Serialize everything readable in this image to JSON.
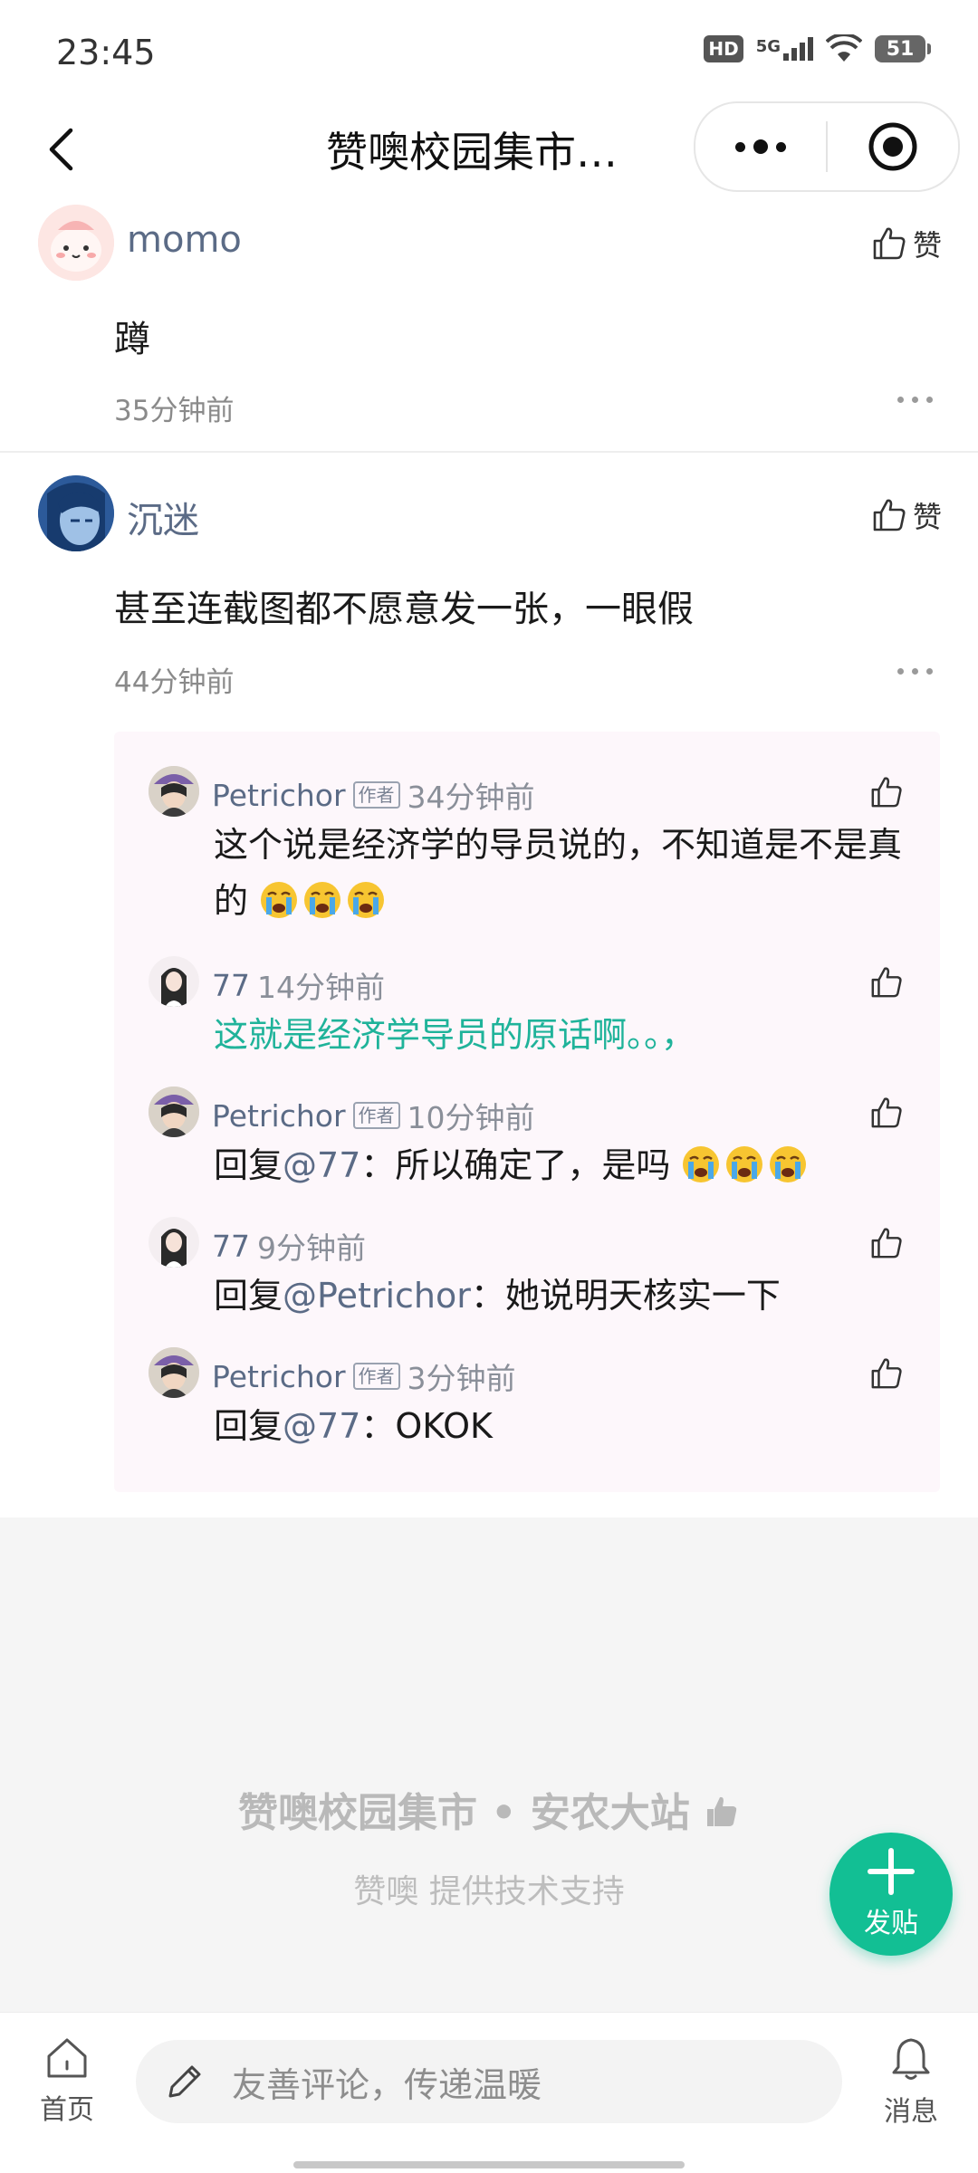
{
  "status_bar": {
    "time": "23:45",
    "hd": "HD",
    "network": "5G",
    "battery": "51"
  },
  "nav": {
    "title": "赞噢校园集市…"
  },
  "comments": [
    {
      "username": "momo",
      "text": "蹲",
      "time": "35分钟前",
      "like_label": "赞"
    },
    {
      "username": "沉迷",
      "text": "甚至连截图都不愿意发一张，一眼假",
      "time": "44分钟前",
      "like_label": "赞"
    }
  ],
  "replies": [
    {
      "name": "Petrichor",
      "badge": "作者",
      "time": "34分钟前",
      "text": "这个说是经济学的导员说的，不知道是不是真的"
    },
    {
      "name": "77",
      "time": "14分钟前",
      "text": "这就是经济学导员的原话啊。。，"
    },
    {
      "name": "Petrichor",
      "badge": "作者",
      "time": "10分钟前",
      "prefix": "回复",
      "mention": "@77",
      "text": "：所以确定了，是吗"
    },
    {
      "name": "77",
      "time": "9分钟前",
      "prefix": "回复",
      "mention": "@Petrichor",
      "text": "：她说明天核实一下"
    },
    {
      "name": "Petrichor",
      "badge": "作者",
      "time": "3分钟前",
      "prefix": "回复",
      "mention": "@77",
      "text": "：OKOK"
    }
  ],
  "footer": {
    "brand": "赞噢校园集市 • 安农大站",
    "support": "赞噢 提供技术支持"
  },
  "fab": {
    "label": "发贴"
  },
  "bottom_bar": {
    "home_label": "首页",
    "input_placeholder": "友善评论，传递温暖",
    "messages_label": "消息"
  },
  "colors": {
    "accent": "#12bf94",
    "link": "#5b6b86",
    "teal_text": "#1fb39a",
    "reply_bg": "#fdf7fb"
  },
  "icons": [
    "back-arrow-icon",
    "more-dots-icon",
    "target-close-icon",
    "thumb-up-icon",
    "crying-emoji-icon",
    "plus-icon",
    "home-icon",
    "pen-icon",
    "bell-icon"
  ]
}
